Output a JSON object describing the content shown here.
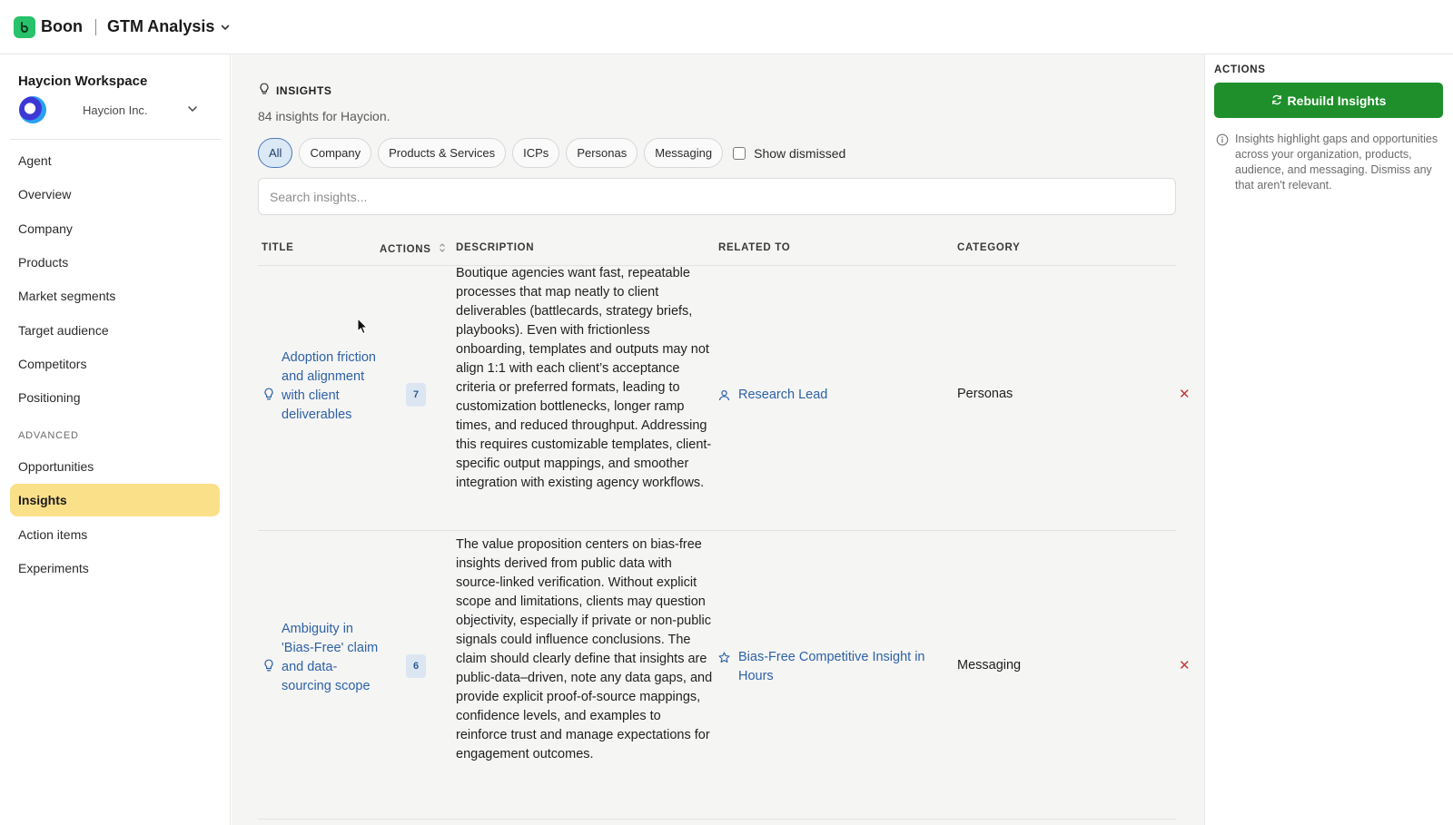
{
  "topbar": {
    "brand": "Boon",
    "project": "GTM Analysis",
    "icons": {
      "logo": "boon-logo-icon",
      "project_chevron": "chevron-down-icon"
    }
  },
  "sidebar": {
    "workspace_title": "Haycion Workspace",
    "org_name": "Haycion Inc.",
    "nav": [
      {
        "label": "Agent"
      },
      {
        "label": "Overview"
      },
      {
        "label": "Company"
      },
      {
        "label": "Products"
      },
      {
        "label": "Market segments"
      },
      {
        "label": "Target audience"
      },
      {
        "label": "Competitors"
      },
      {
        "label": "Positioning"
      }
    ],
    "advanced_label": "ADVANCED",
    "advanced_nav": [
      {
        "label": "Opportunities"
      },
      {
        "label": "Insights",
        "active": true
      },
      {
        "label": "Action items"
      },
      {
        "label": "Experiments"
      }
    ]
  },
  "main": {
    "section_title": "INSIGHTS",
    "subtitle": "84 insights for Haycion.",
    "filters": [
      "All",
      "Company",
      "Products & Services",
      "ICPs",
      "Personas",
      "Messaging"
    ],
    "active_filter": "All",
    "show_dismissed_label": "Show dismissed",
    "show_dismissed_checked": false,
    "search_placeholder": "Search insights...",
    "columns": {
      "title": "TITLE",
      "actions": "ACTIONS",
      "description": "DESCRIPTION",
      "related_to": "RELATED TO",
      "category": "CATEGORY"
    },
    "rows": [
      {
        "title": "Adoption friction and alignment with client deliverables",
        "actions_count": "7",
        "description": "Boutique agencies want fast, repeatable processes that map neatly to client deliverables (battlecards, strategy briefs, playbooks). Even with frictionless onboarding, templates and outputs may not align 1:1 with each client’s acceptance criteria or preferred formats, leading to customization bottlenecks, longer ramp times, and reduced throughput. Addressing this requires customizable templates, client-specific output mappings, and smoother integration with existing agency workflows.",
        "related_to": "Research Lead",
        "related_icon": "person-icon",
        "category": "Personas"
      },
      {
        "title": "Ambiguity in 'Bias-Free' claim and data-sourcing scope",
        "actions_count": "6",
        "description": "The value proposition centers on bias-free insights derived from public data with source-linked verification. Without explicit scope and limitations, clients may question objectivity, especially if private or non-public signals could influence conclusions. The claim should clearly define that insights are public-data–driven, note any data gaps, and provide explicit proof-of-source mappings, confidence levels, and examples to reinforce trust and manage expectations for engagement outcomes.",
        "related_to": "Bias-Free Competitive Insight in Hours",
        "related_icon": "star-icon",
        "category": "Messaging"
      }
    ]
  },
  "right_panel": {
    "title": "ACTIONS",
    "rebuild_label": "Rebuild Insights",
    "info_text": "Insights highlight gaps and opportunities across your organization, products, audience, and messaging. Dismiss any that aren't relevant."
  },
  "colors": {
    "accent_green": "#1e8f2b",
    "active_nav": "#fbe08a",
    "link_blue": "#2e62a6",
    "dismiss_red": "#c23a3a"
  }
}
